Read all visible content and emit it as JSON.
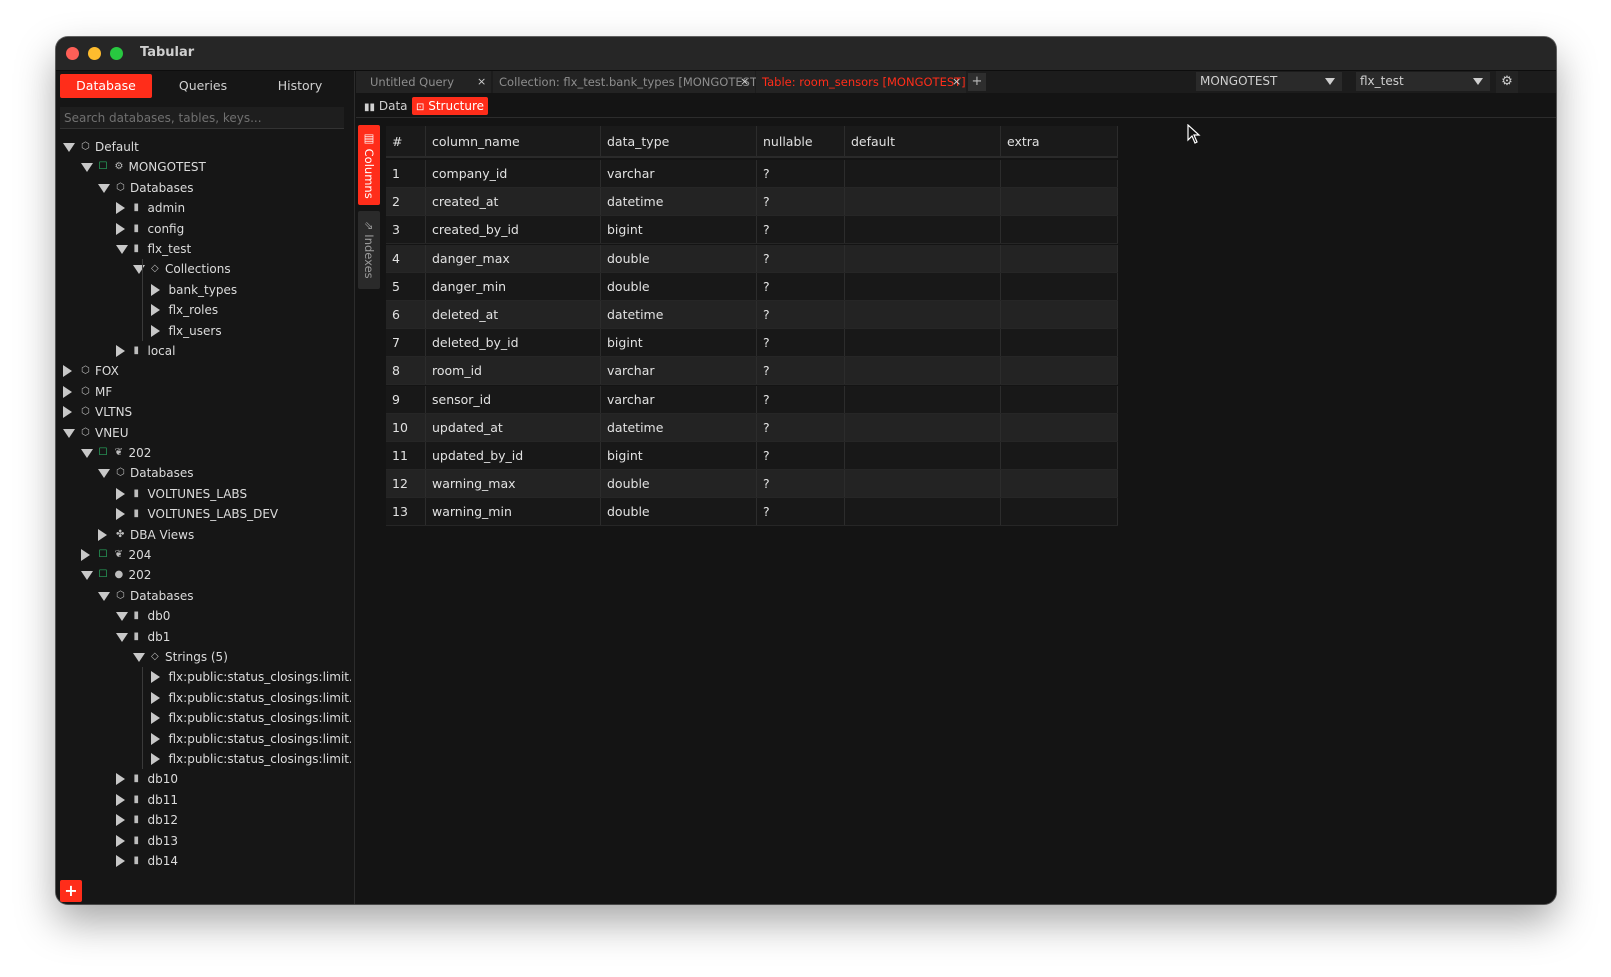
{
  "app": {
    "title": "Tabular"
  },
  "sidebar": {
    "tabs": [
      {
        "label": "Database",
        "active": true
      },
      {
        "label": "Queries",
        "active": false
      },
      {
        "label": "History",
        "active": false
      }
    ],
    "search_placeholder": "Search databases, tables, keys...",
    "add_label": "+"
  },
  "tree": [
    {
      "label": "Default",
      "level": 0,
      "expanded": true,
      "icon": "group-icon"
    },
    {
      "label": "MONGOTEST",
      "level": 1,
      "expanded": true,
      "icon": "mongo-icon",
      "status": true
    },
    {
      "label": "Databases",
      "level": 2,
      "expanded": true,
      "icon": "group-icon"
    },
    {
      "label": "admin",
      "level": 3,
      "expanded": false,
      "icon": "database-icon"
    },
    {
      "label": "config",
      "level": 3,
      "expanded": false,
      "icon": "database-icon"
    },
    {
      "label": "flx_test",
      "level": 3,
      "expanded": true,
      "icon": "database-icon"
    },
    {
      "label": "Collections",
      "level": 4,
      "expanded": true,
      "icon": "tag-icon"
    },
    {
      "label": "bank_types",
      "level": 5,
      "expanded": false,
      "icon": ""
    },
    {
      "label": "flx_roles",
      "level": 5,
      "expanded": false,
      "icon": ""
    },
    {
      "label": "flx_users",
      "level": 5,
      "expanded": false,
      "icon": ""
    },
    {
      "label": "local",
      "level": 3,
      "expanded": false,
      "icon": "database-icon"
    },
    {
      "label": "FOX",
      "level": 0,
      "expanded": false,
      "icon": "group-icon"
    },
    {
      "label": "MF",
      "level": 0,
      "expanded": false,
      "icon": "group-icon"
    },
    {
      "label": "VLTNS",
      "level": 0,
      "expanded": false,
      "icon": "group-icon"
    },
    {
      "label": "VNEU",
      "level": 0,
      "expanded": true,
      "icon": "group-icon"
    },
    {
      "label": "202",
      "level": 1,
      "expanded": true,
      "icon": "leaf-icon",
      "status": true
    },
    {
      "label": "Databases",
      "level": 2,
      "expanded": true,
      "icon": "group-icon"
    },
    {
      "label": "VOLTUNES_LABS",
      "level": 3,
      "expanded": false,
      "icon": "database-icon"
    },
    {
      "label": "VOLTUNES_LABS_DEV",
      "level": 3,
      "expanded": false,
      "icon": "database-icon"
    },
    {
      "label": "DBA Views",
      "level": 2,
      "expanded": false,
      "icon": "views-icon"
    },
    {
      "label": "204",
      "level": 1,
      "expanded": false,
      "icon": "leaf-icon",
      "status": true
    },
    {
      "label": "202",
      "level": 1,
      "expanded": true,
      "icon": "circle-icon",
      "status": true
    },
    {
      "label": "Databases",
      "level": 2,
      "expanded": true,
      "icon": "group-icon"
    },
    {
      "label": "db0",
      "level": 3,
      "expanded": true,
      "icon": "database-icon"
    },
    {
      "label": "db1",
      "level": 3,
      "expanded": true,
      "icon": "database-icon"
    },
    {
      "label": "Strings (5)",
      "level": 4,
      "expanded": true,
      "icon": "tag-icon"
    },
    {
      "label": "flx:public:status_closings:limit...",
      "level": 5,
      "expanded": false,
      "icon": ""
    },
    {
      "label": "flx:public:status_closings:limit...",
      "level": 5,
      "expanded": false,
      "icon": ""
    },
    {
      "label": "flx:public:status_closings:limit...",
      "level": 5,
      "expanded": false,
      "icon": ""
    },
    {
      "label": "flx:public:status_closings:limit...",
      "level": 5,
      "expanded": false,
      "icon": ""
    },
    {
      "label": "flx:public:status_closings:limit...",
      "level": 5,
      "expanded": false,
      "icon": ""
    },
    {
      "label": "db10",
      "level": 3,
      "expanded": false,
      "icon": "database-icon"
    },
    {
      "label": "db11",
      "level": 3,
      "expanded": false,
      "icon": "database-icon"
    },
    {
      "label": "db12",
      "level": 3,
      "expanded": false,
      "icon": "database-icon"
    },
    {
      "label": "db13",
      "level": 3,
      "expanded": false,
      "icon": "database-icon"
    },
    {
      "label": "db14",
      "level": 3,
      "expanded": false,
      "icon": "database-icon"
    }
  ],
  "tabs": [
    {
      "label": "Untitled Query",
      "active": false,
      "close": "×"
    },
    {
      "label": "Collection: flx_test.bank_types [MONGOTEST]",
      "active": false,
      "close": "×"
    },
    {
      "label": "Table: room_sensors [MONGOTEST]",
      "active": true,
      "close": "×"
    }
  ],
  "new_tab_label": "+",
  "connection_select": {
    "value": "MONGOTEST"
  },
  "database_select": {
    "value": "flx_test"
  },
  "view_buttons": [
    {
      "label": "Data",
      "active": false,
      "icon": "bar-chart-icon"
    },
    {
      "label": "Structure",
      "active": true,
      "icon": "structure-icon"
    }
  ],
  "side_tabs": [
    {
      "label": "Columns",
      "active": true
    },
    {
      "label": "Indexes",
      "active": false
    }
  ],
  "table": {
    "columns": [
      "#",
      "column_name",
      "data_type",
      "nullable",
      "default",
      "extra"
    ],
    "rows": [
      [
        "1",
        "company_id",
        "varchar",
        "?",
        "",
        ""
      ],
      [
        "2",
        "created_at",
        "datetime",
        "?",
        "",
        ""
      ],
      [
        "3",
        "created_by_id",
        "bigint",
        "?",
        "",
        ""
      ],
      [
        "4",
        "danger_max",
        "double",
        "?",
        "",
        ""
      ],
      [
        "5",
        "danger_min",
        "double",
        "?",
        "",
        ""
      ],
      [
        "6",
        "deleted_at",
        "datetime",
        "?",
        "",
        ""
      ],
      [
        "7",
        "deleted_by_id",
        "bigint",
        "?",
        "",
        ""
      ],
      [
        "8",
        "room_id",
        "varchar",
        "?",
        "",
        ""
      ],
      [
        "9",
        "sensor_id",
        "varchar",
        "?",
        "",
        ""
      ],
      [
        "10",
        "updated_at",
        "datetime",
        "?",
        "",
        ""
      ],
      [
        "11",
        "updated_by_id",
        "bigint",
        "?",
        "",
        ""
      ],
      [
        "12",
        "warning_max",
        "double",
        "?",
        "",
        ""
      ],
      [
        "13",
        "warning_min",
        "double",
        "?",
        "",
        ""
      ]
    ]
  },
  "colors": {
    "accent": "#ff2d1a",
    "status": "#2ecc71",
    "background": "#141414"
  }
}
